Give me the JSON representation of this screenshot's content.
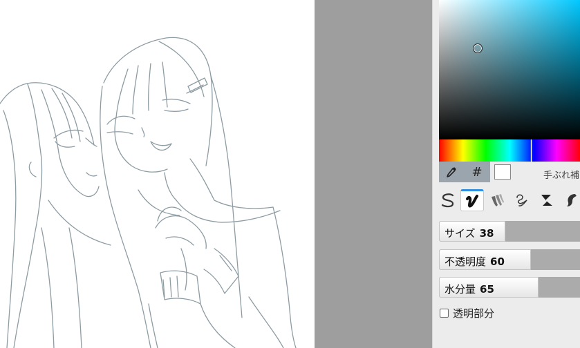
{
  "color_picker": {
    "base_hue_color": "#00c8ff",
    "swatch_color": "#ffffff",
    "hash_symbol": "#",
    "stabilizer_label": "手ぶれ補"
  },
  "icons": {
    "eyedropper": "eyedropper-icon",
    "brushes": [
      "brush-pen-icon",
      "brush-ink-icon",
      "brush-watercolor-icon",
      "brush-sketch-icon",
      "brush-eraser-icon",
      "brush-blur-icon"
    ]
  },
  "sliders": {
    "size": {
      "label": "サイズ",
      "value": "38",
      "fraction": 0.47
    },
    "opacity": {
      "label": "不透明度",
      "value": "60",
      "fraction": 0.65
    },
    "water": {
      "label": "水分量",
      "value": "65",
      "fraction": 0.7
    }
  },
  "transparent": {
    "label": "透明部分",
    "checked": false
  },
  "colors": {
    "accent": "#2f8fe0",
    "sketch_stroke": "#8d9ca3"
  }
}
